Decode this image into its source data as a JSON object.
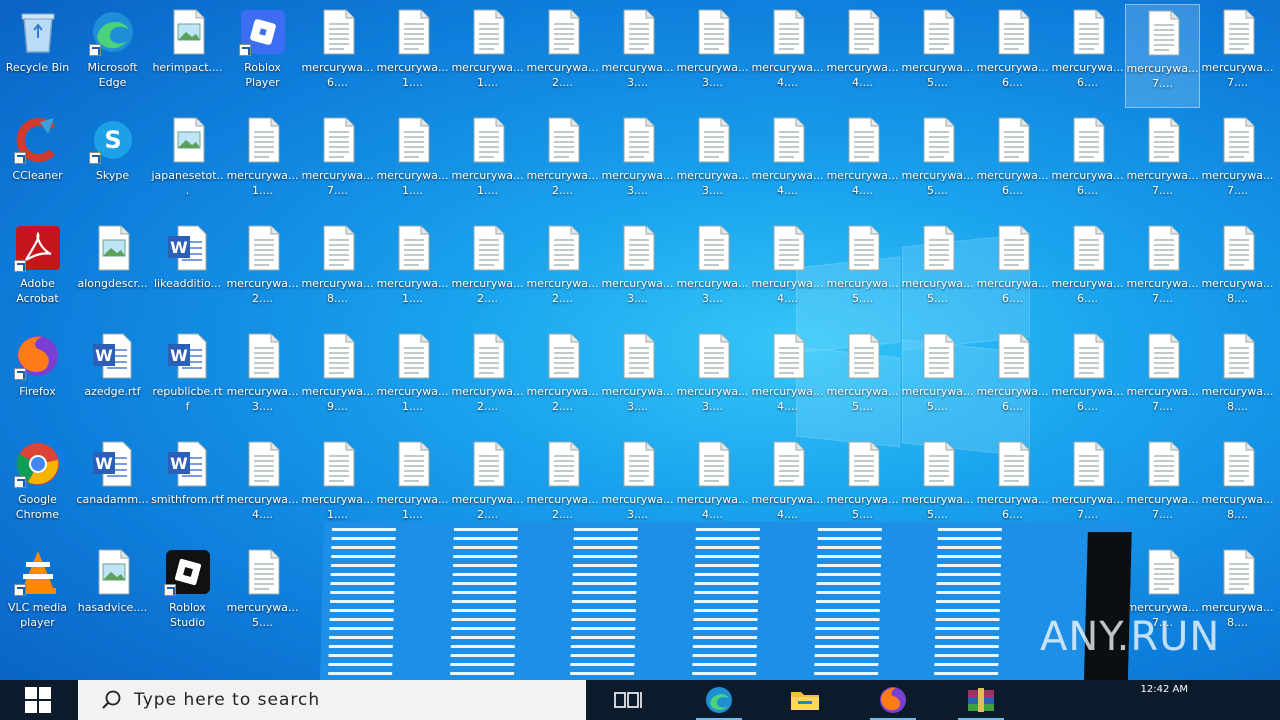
{
  "desktop": {
    "icons": [
      {
        "label": "Recycle Bin",
        "type": "recycle"
      },
      {
        "label": "Microsoft Edge",
        "type": "edge"
      },
      {
        "label": "herimpact....",
        "type": "image"
      },
      {
        "label": "Roblox Player",
        "type": "roblox"
      },
      {
        "label": "mercurywa... 6....",
        "type": "doc"
      },
      {
        "label": "mercurywa... 1....",
        "type": "doc"
      },
      {
        "label": "mercurywa... 1....",
        "type": "doc"
      },
      {
        "label": "mercurywa... 2....",
        "type": "doc"
      },
      {
        "label": "mercurywa... 3....",
        "type": "doc"
      },
      {
        "label": "mercurywa... 3....",
        "type": "doc"
      },
      {
        "label": "mercurywa... 4....",
        "type": "doc"
      },
      {
        "label": "mercurywa... 4....",
        "type": "doc"
      },
      {
        "label": "mercurywa... 5....",
        "type": "doc"
      },
      {
        "label": "mercurywa... 6....",
        "type": "doc"
      },
      {
        "label": "mercurywa... 6....",
        "type": "doc"
      },
      {
        "label": "mercurywa... 7....",
        "type": "doc",
        "selected": true
      },
      {
        "label": "mercurywa... 7....",
        "type": "doc"
      },
      {
        "label": "CCleaner",
        "type": "ccleaner"
      },
      {
        "label": "Skype",
        "type": "skype"
      },
      {
        "label": "japanesetot...",
        "type": "image"
      },
      {
        "label": "mercurywa... 1....",
        "type": "doc"
      },
      {
        "label": "mercurywa... 7....",
        "type": "doc"
      },
      {
        "label": "mercurywa... 1....",
        "type": "doc"
      },
      {
        "label": "mercurywa... 1....",
        "type": "doc"
      },
      {
        "label": "mercurywa... 2....",
        "type": "doc"
      },
      {
        "label": "mercurywa... 3....",
        "type": "doc"
      },
      {
        "label": "mercurywa... 3....",
        "type": "doc"
      },
      {
        "label": "mercurywa... 4....",
        "type": "doc"
      },
      {
        "label": "mercurywa... 4....",
        "type": "doc"
      },
      {
        "label": "mercurywa... 5....",
        "type": "doc"
      },
      {
        "label": "mercurywa... 6....",
        "type": "doc"
      },
      {
        "label": "mercurywa... 6....",
        "type": "doc"
      },
      {
        "label": "mercurywa... 7....",
        "type": "doc"
      },
      {
        "label": "mercurywa... 7....",
        "type": "doc"
      },
      {
        "label": "Adobe Acrobat",
        "type": "acrobat"
      },
      {
        "label": "alongdescr...",
        "type": "image"
      },
      {
        "label": "likeadditio...",
        "type": "word"
      },
      {
        "label": "mercurywa... 2....",
        "type": "doc"
      },
      {
        "label": "mercurywa... 8....",
        "type": "doc"
      },
      {
        "label": "mercurywa... 1....",
        "type": "doc"
      },
      {
        "label": "mercurywa... 2....",
        "type": "doc"
      },
      {
        "label": "mercurywa... 2....",
        "type": "doc"
      },
      {
        "label": "mercurywa... 3....",
        "type": "doc"
      },
      {
        "label": "mercurywa... 3....",
        "type": "doc"
      },
      {
        "label": "mercurywa... 4....",
        "type": "doc"
      },
      {
        "label": "mercurywa... 5....",
        "type": "doc"
      },
      {
        "label": "mercurywa... 5....",
        "type": "doc"
      },
      {
        "label": "mercurywa... 6....",
        "type": "doc"
      },
      {
        "label": "mercurywa... 6....",
        "type": "doc"
      },
      {
        "label": "mercurywa... 7....",
        "type": "doc"
      },
      {
        "label": "mercurywa... 8....",
        "type": "doc"
      },
      {
        "label": "Firefox",
        "type": "firefox"
      },
      {
        "label": "azedge.rtf",
        "type": "word"
      },
      {
        "label": "republicbe.rtf",
        "type": "word"
      },
      {
        "label": "mercurywa... 3....",
        "type": "doc"
      },
      {
        "label": "mercurywa... 9....",
        "type": "doc"
      },
      {
        "label": "mercurywa... 1....",
        "type": "doc"
      },
      {
        "label": "mercurywa... 2....",
        "type": "doc"
      },
      {
        "label": "mercurywa... 2....",
        "type": "doc"
      },
      {
        "label": "mercurywa... 3....",
        "type": "doc"
      },
      {
        "label": "mercurywa... 3....",
        "type": "doc"
      },
      {
        "label": "mercurywa... 4....",
        "type": "doc"
      },
      {
        "label": "mercurywa... 5....",
        "type": "doc"
      },
      {
        "label": "mercurywa... 5....",
        "type": "doc"
      },
      {
        "label": "mercurywa... 6....",
        "type": "doc"
      },
      {
        "label": "mercurywa... 6....",
        "type": "doc"
      },
      {
        "label": "mercurywa... 7....",
        "type": "doc"
      },
      {
        "label": "mercurywa... 8....",
        "type": "doc"
      },
      {
        "label": "Google Chrome",
        "type": "chrome"
      },
      {
        "label": "canadamm...",
        "type": "word"
      },
      {
        "label": "smithfrom.rtf",
        "type": "word"
      },
      {
        "label": "mercurywa... 4....",
        "type": "doc"
      },
      {
        "label": "mercurywa... 1....",
        "type": "doc"
      },
      {
        "label": "mercurywa... 1....",
        "type": "doc"
      },
      {
        "label": "mercurywa... 2....",
        "type": "doc"
      },
      {
        "label": "mercurywa... 2....",
        "type": "doc"
      },
      {
        "label": "mercurywa... 3....",
        "type": "doc"
      },
      {
        "label": "mercurywa... 4....",
        "type": "doc"
      },
      {
        "label": "mercurywa... 4....",
        "type": "doc"
      },
      {
        "label": "mercurywa... 5....",
        "type": "doc"
      },
      {
        "label": "mercurywa... 5....",
        "type": "doc"
      },
      {
        "label": "mercurywa... 6....",
        "type": "doc"
      },
      {
        "label": "mercurywa... 7....",
        "type": "doc"
      },
      {
        "label": "mercurywa... 7....",
        "type": "doc"
      },
      {
        "label": "mercurywa... 8....",
        "type": "doc"
      },
      {
        "label": "VLC media player",
        "type": "vlc"
      },
      {
        "label": "hasadvice....",
        "type": "image"
      },
      {
        "label": "Roblox Studio",
        "type": "robloxstudio"
      },
      {
        "label": "mercurywa... 5....",
        "type": "doc"
      },
      {
        "label": "mercurywa... 7....",
        "type": "doc",
        "col": 15
      },
      {
        "label": "mercurywa... 8....",
        "type": "doc",
        "col": 16
      }
    ]
  },
  "watermark": {
    "text": "ANY.RUN"
  },
  "taskbar": {
    "search_placeholder": "Type here to search",
    "clock": "12:42 AM"
  }
}
